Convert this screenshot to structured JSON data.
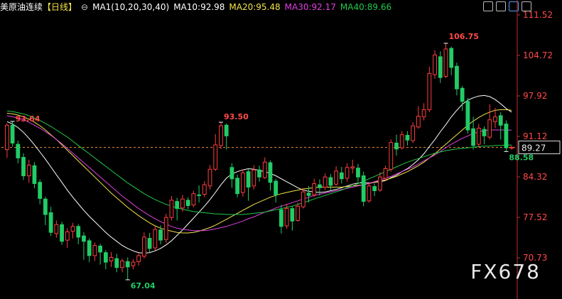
{
  "header": {
    "symbol": "美原油连续",
    "period": "【日线】",
    "ma_label": "MA1(10,20,30,40)",
    "ma10": "MA10:92.98",
    "ma20": "MA20:95.48",
    "ma30": "MA30:92.17",
    "ma40": "MA40:89.66"
  },
  "watermark": "FX678",
  "colors": {
    "up": "#ff3d3d",
    "down": "#22cc66",
    "ma10": "#ffffff",
    "ma20": "#f2e24a",
    "ma30": "#e040e0",
    "ma40": "#22c84a",
    "axis": "#c03030",
    "current": "#e08a30"
  },
  "chart_data": {
    "type": "candlestick",
    "y_ticks": [
      "111.52",
      "104.72",
      "97.92",
      "91.12",
      "84.32",
      "77.52",
      "70.73"
    ],
    "ylim": [
      67.0,
      111.52
    ],
    "current_price": "89.27",
    "annotations": {
      "high_left": "93.64",
      "low": "67.04",
      "mid_high": "93.50",
      "peak": "106.75",
      "last_low": "88.58"
    },
    "candles": [
      [
        88.9,
        93.0,
        87.5,
        93.3
      ],
      [
        93.0,
        90.0,
        89.4,
        93.6
      ],
      [
        89.8,
        87.5,
        86.6,
        90.4
      ],
      [
        87.6,
        84.5,
        83.8,
        88.3
      ],
      [
        84.5,
        86.3,
        83.3,
        87.2
      ],
      [
        86.2,
        83.2,
        82.4,
        86.8
      ],
      [
        83.4,
        80.7,
        79.7,
        83.9
      ],
      [
        80.6,
        78.0,
        76.2,
        81.0
      ],
      [
        78.3,
        75.0,
        74.4,
        79.3
      ],
      [
        74.8,
        76.3,
        74.1,
        77.0
      ],
      [
        76.3,
        73.5,
        72.9,
        76.8
      ],
      [
        73.7,
        75.1,
        72.4,
        75.7
      ],
      [
        75.2,
        76.0,
        74.0,
        76.6
      ],
      [
        76.0,
        74.2,
        73.0,
        76.4
      ],
      [
        74.4,
        73.5,
        70.4,
        75.0
      ],
      [
        73.6,
        71.1,
        70.0,
        74.0
      ],
      [
        71.1,
        72.8,
        70.2,
        73.3
      ],
      [
        72.7,
        71.7,
        69.6,
        73.1
      ],
      [
        71.6,
        70.0,
        68.8,
        72.0
      ],
      [
        70.2,
        70.8,
        69.2,
        71.7
      ],
      [
        70.6,
        69.1,
        68.3,
        71.4
      ],
      [
        69.1,
        70.2,
        68.3,
        70.6
      ],
      [
        70.1,
        69.2,
        67.04,
        70.8
      ],
      [
        69.4,
        70.0,
        68.8,
        70.5
      ],
      [
        70.1,
        71.1,
        69.4,
        71.5
      ],
      [
        71.0,
        74.2,
        70.6,
        75.0
      ],
      [
        74.0,
        72.3,
        71.6,
        74.9
      ],
      [
        72.4,
        75.5,
        72.0,
        76.0
      ],
      [
        75.4,
        73.7,
        73.0,
        76.2
      ],
      [
        73.8,
        77.5,
        73.2,
        78.1
      ],
      [
        77.5,
        80.4,
        77.0,
        81.1
      ],
      [
        80.2,
        79.0,
        77.0,
        80.8
      ],
      [
        79.1,
        80.6,
        78.5,
        81.3
      ],
      [
        80.4,
        79.5,
        78.9,
        80.9
      ],
      [
        79.6,
        81.5,
        79.2,
        82.0
      ],
      [
        81.3,
        81.2,
        80.0,
        82.9
      ],
      [
        81.4,
        83.0,
        80.9,
        83.6
      ],
      [
        82.8,
        85.6,
        82.2,
        86.3
      ],
      [
        85.6,
        89.7,
        85.3,
        91.5
      ],
      [
        89.6,
        92.9,
        89.0,
        93.5
      ],
      [
        93.0,
        91.2,
        88.9,
        93.3
      ],
      [
        85.9,
        84.0,
        82.5,
        86.6
      ],
      [
        84.1,
        81.5,
        80.9,
        84.7
      ],
      [
        81.7,
        85.0,
        81.0,
        85.6
      ],
      [
        85.2,
        82.6,
        80.3,
        85.7
      ],
      [
        82.8,
        85.5,
        82.2,
        86.3
      ],
      [
        85.5,
        84.3,
        83.5,
        86.2
      ],
      [
        84.2,
        86.8,
        84.0,
        87.6
      ],
      [
        86.7,
        83.4,
        82.0,
        87.1
      ],
      [
        83.6,
        81.3,
        80.0,
        84.0
      ],
      [
        78.8,
        76.0,
        74.8,
        79.6
      ],
      [
        76.1,
        79.0,
        75.6,
        79.8
      ],
      [
        79.0,
        76.9,
        75.3,
        79.4
      ],
      [
        77.0,
        79.4,
        76.8,
        80.0
      ],
      [
        79.3,
        81.8,
        79.0,
        82.4
      ],
      [
        81.6,
        81.2,
        80.0,
        82.8
      ],
      [
        81.3,
        83.2,
        81.0,
        84.0
      ],
      [
        83.0,
        82.5,
        81.2,
        83.9
      ],
      [
        82.6,
        84.3,
        82.1,
        84.9
      ],
      [
        84.2,
        82.9,
        82.1,
        84.8
      ],
      [
        83.1,
        85.3,
        82.8,
        86.1
      ],
      [
        85.0,
        84.0,
        83.2,
        86.0
      ],
      [
        84.1,
        85.9,
        83.5,
        86.6
      ],
      [
        85.8,
        86.0,
        84.9,
        87.2
      ],
      [
        85.8,
        84.3,
        83.5,
        86.5
      ],
      [
        84.5,
        80.2,
        79.4,
        85.2
      ],
      [
        80.3,
        82.8,
        80.0,
        83.4
      ],
      [
        82.7,
        82.0,
        81.1,
        83.2
      ],
      [
        82.1,
        84.3,
        81.8,
        85.1
      ],
      [
        84.1,
        85.7,
        83.6,
        86.2
      ],
      [
        85.6,
        90.1,
        85.2,
        90.6
      ],
      [
        90.0,
        89.0,
        87.9,
        91.4
      ],
      [
        89.2,
        91.4,
        88.9,
        92.0
      ],
      [
        91.3,
        90.5,
        89.6,
        92.0
      ],
      [
        90.4,
        92.9,
        90.0,
        93.5
      ],
      [
        92.7,
        94.5,
        92.4,
        96.2
      ],
      [
        94.4,
        95.6,
        93.8,
        96.7
      ],
      [
        95.6,
        101.7,
        95.2,
        102.8
      ],
      [
        101.5,
        104.8,
        100.8,
        105.6
      ],
      [
        104.5,
        101.0,
        100.1,
        105.4
      ],
      [
        101.2,
        105.8,
        100.9,
        106.75
      ],
      [
        105.9,
        102.7,
        101.4,
        106.2
      ],
      [
        102.9,
        99.1,
        98.0,
        103.5
      ],
      [
        99.2,
        97.0,
        95.4,
        99.6
      ],
      [
        97.0,
        92.2,
        91.6,
        97.6
      ],
      [
        92.4,
        89.6,
        88.9,
        94.4
      ],
      [
        89.8,
        92.5,
        89.3,
        93.2
      ],
      [
        92.3,
        91.2,
        89.8,
        92.8
      ],
      [
        91.0,
        93.9,
        90.6,
        96.5
      ],
      [
        93.6,
        94.4,
        92.5,
        95.9
      ],
      [
        94.6,
        93.0,
        90.6,
        95.2
      ],
      [
        93.2,
        89.2,
        88.58,
        93.8
      ],
      [
        89.2,
        89.27,
        88.9,
        89.6
      ]
    ],
    "ma": {
      "ma10": [
        93.6,
        93.2,
        92.6,
        91.8,
        90.8,
        89.7,
        88.5,
        87.3,
        86.0,
        84.7,
        83.4,
        82.1,
        80.9,
        79.8,
        78.7,
        77.7,
        76.8,
        75.9,
        75.0,
        74.2,
        73.5,
        72.8,
        72.3,
        71.9,
        71.6,
        71.5,
        71.6,
        71.9,
        72.3,
        72.9,
        73.6,
        74.5,
        75.4,
        76.4,
        77.4,
        78.4,
        79.4,
        80.5,
        81.7,
        83.0,
        84.1,
        84.8,
        85.2,
        85.5,
        85.7,
        85.6,
        85.4,
        85.2,
        84.9,
        84.5,
        84.0,
        83.5,
        83.0,
        82.5,
        82.1,
        81.9,
        81.8,
        81.7,
        81.8,
        82.0,
        82.2,
        82.5,
        82.8,
        83.1,
        83.3,
        83.3,
        83.3,
        83.4,
        83.5,
        83.7,
        84.2,
        84.6,
        85.2,
        85.7,
        86.4,
        87.2,
        88.2,
        89.4,
        90.6,
        91.9,
        93.1,
        94.4,
        95.5,
        96.5,
        97.2,
        97.6,
        97.9,
        98.0,
        97.8,
        97.3,
        96.6,
        95.8,
        95.2
      ],
      "ma20": [
        95.0,
        94.9,
        94.7,
        94.4,
        94.0,
        93.5,
        92.9,
        92.2,
        91.4,
        90.6,
        89.7,
        88.8,
        87.9,
        87.0,
        86.1,
        85.2,
        84.3,
        83.4,
        82.5,
        81.6,
        80.8,
        80.0,
        79.2,
        78.5,
        77.8,
        77.2,
        76.6,
        76.1,
        75.7,
        75.4,
        75.2,
        75.0,
        74.9,
        74.9,
        75.0,
        75.2,
        75.5,
        75.8,
        76.2,
        76.7,
        77.2,
        77.7,
        78.2,
        78.7,
        79.2,
        79.7,
        80.1,
        80.5,
        80.9,
        81.2,
        81.5,
        81.7,
        81.9,
        82.1,
        82.3,
        82.4,
        82.5,
        82.6,
        82.6,
        82.6,
        82.6,
        82.6,
        82.7,
        82.8,
        82.9,
        83.0,
        83.2,
        83.4,
        83.6,
        83.8,
        84.1,
        84.4,
        84.8,
        85.2,
        85.7,
        86.2,
        86.8,
        87.5,
        88.2,
        89.0,
        89.8,
        90.6,
        91.4,
        92.2,
        93.0,
        93.7,
        94.3,
        94.8,
        95.2,
        95.5,
        95.6,
        95.6,
        95.5
      ],
      "ma30": [
        94.6,
        94.4,
        94.2,
        93.9,
        93.5,
        93.0,
        92.5,
        91.9,
        91.3,
        90.6,
        89.9,
        89.1,
        88.3,
        87.5,
        86.7,
        85.9,
        85.1,
        84.3,
        83.5,
        82.7,
        81.9,
        81.1,
        80.4,
        79.7,
        79.0,
        78.4,
        77.8,
        77.3,
        76.8,
        76.4,
        76.0,
        75.7,
        75.5,
        75.4,
        75.3,
        75.3,
        75.3,
        75.4,
        75.6,
        75.8,
        76.0,
        76.3,
        76.6,
        76.9,
        77.3,
        77.6,
        78.0,
        78.4,
        78.7,
        79.1,
        79.4,
        79.7,
        80.0,
        80.3,
        80.6,
        80.9,
        81.2,
        81.4,
        81.6,
        81.8,
        82.0,
        82.2,
        82.4,
        82.6,
        82.8,
        83.0,
        83.2,
        83.5,
        83.8,
        84.1,
        84.4,
        84.8,
        85.2,
        85.6,
        86.0,
        86.5,
        87.0,
        87.5,
        88.0,
        88.6,
        89.2,
        89.8,
        90.3,
        90.8,
        91.2,
        91.6,
        91.9,
        92.1,
        92.2,
        92.2,
        92.2,
        92.2,
        92.17
      ],
      "ma40": [
        95.4,
        95.3,
        95.1,
        94.9,
        94.6,
        94.2,
        93.8,
        93.3,
        92.8,
        92.2,
        91.6,
        91.0,
        90.3,
        89.6,
        88.9,
        88.2,
        87.5,
        86.8,
        86.1,
        85.4,
        84.7,
        84.0,
        83.3,
        82.7,
        82.1,
        81.5,
        81.0,
        80.5,
        80.1,
        79.7,
        79.4,
        79.1,
        78.9,
        78.7,
        78.5,
        78.4,
        78.3,
        78.2,
        78.1,
        78.1,
        78.0,
        78.0,
        78.0,
        78.0,
        78.1,
        78.2,
        78.3,
        78.4,
        78.6,
        78.8,
        79.0,
        79.2,
        79.4,
        79.7,
        80.0,
        80.3,
        80.6,
        80.9,
        81.2,
        81.5,
        81.8,
        82.1,
        82.5,
        82.8,
        83.2,
        83.6,
        84.0,
        84.4,
        84.8,
        85.2,
        85.6,
        86.0,
        86.4,
        86.8,
        87.1,
        87.4,
        87.7,
        88.0,
        88.3,
        88.5,
        88.7,
        88.9,
        89.0,
        89.1,
        89.2,
        89.3,
        89.4,
        89.5,
        89.5,
        89.6,
        89.6,
        89.66,
        89.66
      ]
    }
  }
}
